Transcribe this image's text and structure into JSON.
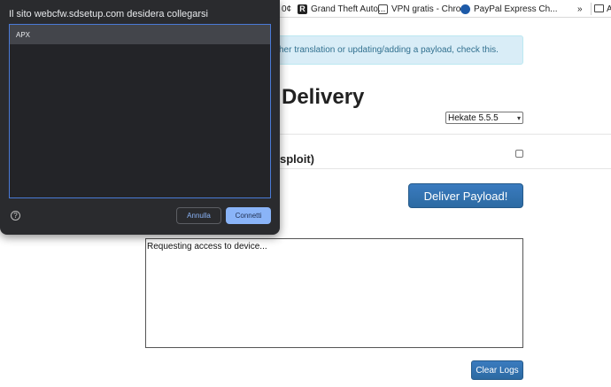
{
  "bookmarks": {
    "items": [
      {
        "label": "0¢",
        "icon": "none"
      },
      {
        "label": "Grand Theft Auto...",
        "icon": "rockstar-icon"
      },
      {
        "label": "VPN gratis - Chro...",
        "icon": "vpn-icon"
      },
      {
        "label": "PayPal Express Ch...",
        "icon": "globe-icon"
      }
    ],
    "overflow": "»",
    "folder_label": "A"
  },
  "page": {
    "alert_text": "her translation or updating/adding a payload, check this.",
    "heading": "Delivery",
    "payload_select_value": "Hekate 5.5.5",
    "option_label": "sploit)",
    "deliver_button": "Deliver Payload!",
    "log_text": "Requesting access to device...",
    "clear_logs_button": "Clear Logs"
  },
  "dialog": {
    "title": "Il sito webcfw.sdsetup.com desidera collegarsi",
    "devices": [
      "APX"
    ],
    "help": "?",
    "cancel_label": "Annulla",
    "connect_label": "Connetti"
  },
  "colors": {
    "primary_button": "#2c6aa2",
    "alert_bg": "#d9edf7",
    "dialog_bg": "#2a2b2e",
    "dialog_accent": "#8ab4f8"
  }
}
